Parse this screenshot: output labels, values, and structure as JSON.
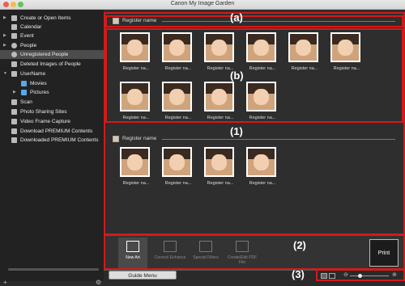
{
  "window": {
    "title": "Canon My Image Garden"
  },
  "sidebar": {
    "items": [
      {
        "label": "Create or Open Items",
        "icon": "create-items-icon",
        "arrow": "▶"
      },
      {
        "label": "Calendar",
        "icon": "calendar-icon",
        "arrow": ""
      },
      {
        "label": "Event",
        "icon": "event-icon",
        "arrow": "▶"
      },
      {
        "label": "People",
        "icon": "people-icon",
        "arrow": "▶"
      },
      {
        "label": "Unregistered People",
        "icon": "unregistered-people-icon",
        "arrow": ""
      },
      {
        "label": "Deleted Images of People",
        "icon": "deleted-people-icon",
        "arrow": ""
      },
      {
        "label": "UserName",
        "icon": "computer-icon",
        "arrow": "▼"
      },
      {
        "label": "Movies",
        "icon": "folder-icon",
        "arrow": ""
      },
      {
        "label": "Pictures",
        "icon": "folder-icon",
        "arrow": "▶"
      },
      {
        "label": "Scan",
        "icon": "scan-icon",
        "arrow": ""
      },
      {
        "label": "Photo Sharing Sites",
        "icon": "photo-sharing-icon",
        "arrow": ""
      },
      {
        "label": "Video Frame Capture",
        "icon": "video-capture-icon",
        "arrow": ""
      },
      {
        "label": "Download PREMIUM Contents",
        "icon": "download-icon",
        "arrow": ""
      },
      {
        "label": "Downloaded PREMIUM Contents",
        "icon": "downloaded-icon",
        "arrow": ""
      }
    ],
    "selected": "Unregistered People",
    "add_symbol": "+",
    "settings_symbol": "⚙"
  },
  "groups": [
    {
      "header": "Register name",
      "count": 0,
      "thumbs": []
    },
    {
      "header": "Register name",
      "count": 10,
      "thumbs": [
        "Register na...",
        "Register na...",
        "Register na...",
        "Register na...",
        "Register na...",
        "Register na...",
        "Register na...",
        "Register na...",
        "Register na...",
        "Register na..."
      ]
    },
    {
      "header": "Register name",
      "count": 4,
      "thumbs": [
        "Register na...",
        "Register na...",
        "Register na...",
        "Register na..."
      ]
    }
  ],
  "callouts": {
    "a": "(a)",
    "b": "(b)",
    "one": "(1)",
    "two": "(2)",
    "three": "(3)"
  },
  "toolbar": {
    "new_art": "New Art",
    "correct_enhance": "Correct/ Enhance",
    "special_filters": "Special Filters",
    "create_edit_pdf": "Create/Edit PDF File",
    "print": "Print"
  },
  "statusbar": {
    "guide_menu": "Guide Menu"
  },
  "zoom": {
    "level": 0.25
  },
  "colors": {
    "accent": "#d31a1a",
    "background": "#2b2b2b",
    "sidebar_selected": "#4c4c4c"
  }
}
